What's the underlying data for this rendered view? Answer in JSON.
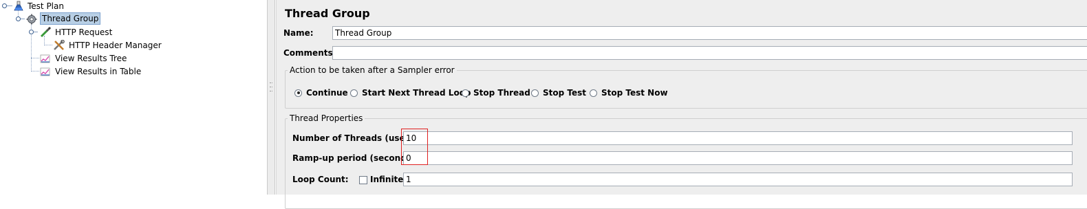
{
  "tree": {
    "test_plan": "Test Plan",
    "thread_group": "Thread Group",
    "http_request": "HTTP Request",
    "header_manager": "HTTP Header Manager",
    "results_tree": "View Results Tree",
    "results_table": "View Results in Table"
  },
  "panel": {
    "title": "Thread Group",
    "name_label": "Name:",
    "name_value": "Thread Group",
    "comments_label": "Comments:",
    "comments_value": "",
    "error_group_title": "Action to be taken after a Sampler error",
    "error_options": [
      "Continue",
      "Start Next Thread Loop",
      "Stop Thread",
      "Stop Test",
      "Stop Test Now"
    ],
    "error_selected": "Continue",
    "props_title": "Thread Properties",
    "threads_label": "Number of Threads (users):",
    "threads_value": "10",
    "rampup_label": "Ramp-up period (seconds):",
    "rampup_value": "0",
    "loop_label": "Loop Count:",
    "infinite_label": "Infinite",
    "infinite_checked": false,
    "loop_value": "1"
  },
  "colors": {
    "selection": "#b8cfe5",
    "highlight_box": "#e02020",
    "panel_bg": "#eeeeee"
  }
}
